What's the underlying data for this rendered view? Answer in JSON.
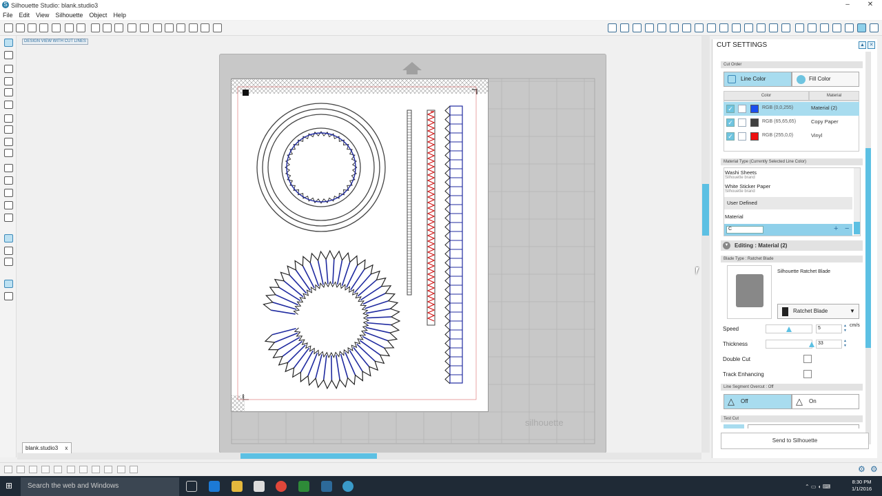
{
  "window": {
    "title": "Silhouette Studio: blank.studio3",
    "controls": [
      "–",
      "❐",
      "✕"
    ]
  },
  "menu": [
    "File",
    "Edit",
    "View",
    "Silhouette",
    "Object",
    "Help"
  ],
  "canvas": {
    "mode_label": "DESIGN VIEW WITH CUT LINES",
    "brand": "silhouette",
    "document_tab": "blank.studio3",
    "tab_close": "x"
  },
  "panel": {
    "title": "CUT SETTINGS",
    "cut_order_label": "Cut Order",
    "line_color_btn": "Line Color",
    "fill_color_btn": "Fill Color",
    "col_color": "Color",
    "col_material": "Material",
    "rows": [
      {
        "rgb": "RGB (0,0,255)",
        "material": "Material (2)",
        "swatch": "#1a4ff0"
      },
      {
        "rgb": "RGB (65,65,65)",
        "material": "Copy Paper",
        "swatch": "#414141"
      },
      {
        "rgb": "RGB (255,0,0)",
        "material": "Vinyl",
        "swatch": "#ee1111"
      }
    ],
    "material_type_label": "Material Type (Currently Selected Line Color)",
    "materials": [
      {
        "name": "Washi Sheets",
        "brand": "Silhouette brand"
      },
      {
        "name": "White Sticker Paper",
        "brand": "Silhouette brand"
      }
    ],
    "user_defined": "User Defined",
    "material_item": "Material",
    "material_input": "C",
    "editing": "Editing : Material (2)",
    "blade_type": "Blade Type : Ratchet Blade",
    "blade_name": "Silhouette Ratchet Blade",
    "blade_select": "Ratchet Blade",
    "speed_label": "Speed",
    "speed_value": "5",
    "speed_unit": "cm/s",
    "thickness_label": "Thickness",
    "thickness_value": "33",
    "double_cut": "Double Cut",
    "track_enhancing": "Track Enhancing",
    "overcut_label": "Line Segment Overcut : Off",
    "off": "Off",
    "on": "On",
    "test_cut": "Test Cut",
    "send": "Send to Silhouette"
  },
  "taskbar": {
    "search": "Search the web and Windows",
    "time": "8:30 PM",
    "date": "1/1/2016"
  },
  "colors": {
    "accent": "#a8dcef",
    "selected": "#5fbde0",
    "blue_line": "#1f2aa0",
    "red_line": "#d01818"
  }
}
